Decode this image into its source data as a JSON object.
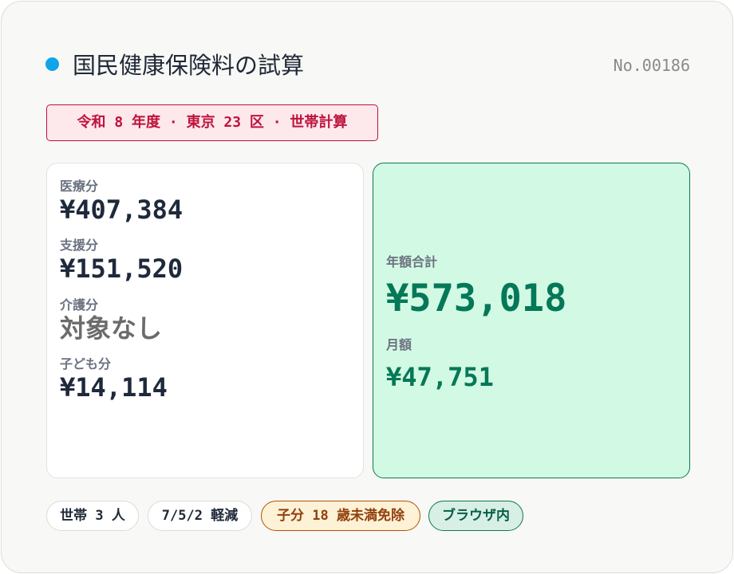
{
  "header": {
    "title": "国民健康保険料の試算",
    "record_no": "No.00186",
    "accent_color": "#0ea5e9"
  },
  "context_tag": {
    "label": "令和 8 年度 · 東京 23 区 · 世帯計算",
    "color": "#be123c"
  },
  "breakdown": {
    "items": [
      {
        "label": "医療分",
        "value": "¥407,384"
      },
      {
        "label": "支援分",
        "value": "¥151,520"
      },
      {
        "label": "介護分",
        "value": "対象なし"
      },
      {
        "label": "子ども分",
        "value": "¥14,114"
      }
    ]
  },
  "summary": {
    "total_label": "年額合計",
    "total_value": "¥573,018",
    "monthly_label": "月額",
    "monthly_value": "¥47,751",
    "accent_color": "#047857"
  },
  "chips": {
    "household": "世帯 3 人",
    "reduction": "7/5/2 軽減",
    "child": "子分 18 歳未満免除",
    "browser": "ブラウザ内"
  }
}
